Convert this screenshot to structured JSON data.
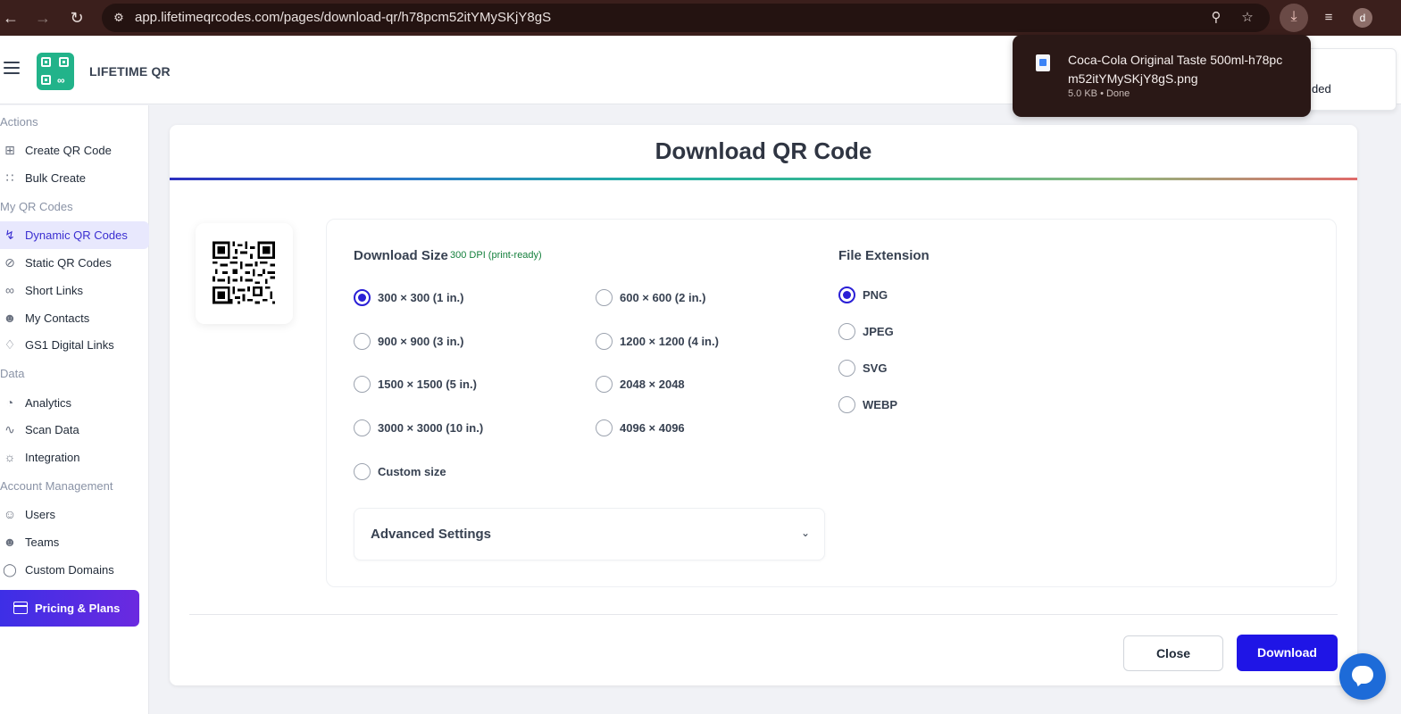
{
  "browser": {
    "url": "app.lifetimeqrcodes.com/pages/download-qr/h78pcm52itYMySKjY8gS",
    "profile_initial": "d",
    "download": {
      "filename": "Coca-Cola Original Taste 500ml-h78pcm52itYMySKjY8gS.png",
      "meta": "5.0 KB • Done"
    }
  },
  "header": {
    "brand": "LIFETIME QR",
    "notice_fragment": "ded"
  },
  "sidebar": {
    "sections": {
      "actions": "Actions",
      "my_qr_codes": "My QR Codes",
      "data": "Data",
      "account": "Account Management"
    },
    "items": [
      {
        "label": "Create QR Code",
        "icon": "plus-square-icon"
      },
      {
        "label": "Bulk Create",
        "icon": "grid-icon"
      },
      {
        "label": "Dynamic QR Codes",
        "icon": "lightning-icon"
      },
      {
        "label": "Static QR Codes",
        "icon": "lightning-off-icon"
      },
      {
        "label": "Short Links",
        "icon": "link-icon"
      },
      {
        "label": "My Contacts",
        "icon": "contacts-icon"
      },
      {
        "label": "GS1 Digital Links",
        "icon": "tag-icon"
      },
      {
        "label": "Analytics",
        "icon": "pie-chart-icon"
      },
      {
        "label": "Scan Data",
        "icon": "activity-icon"
      },
      {
        "label": "Integration",
        "icon": "plug-icon"
      },
      {
        "label": "Users",
        "icon": "user-plus-icon"
      },
      {
        "label": "Teams",
        "icon": "team-icon"
      },
      {
        "label": "Custom Domains",
        "icon": "shield-icon"
      }
    ],
    "pricing_label": "Pricing & Plans"
  },
  "modal": {
    "title": "Download QR Code",
    "download_size_label": "Download Size",
    "dpi_note": "300 DPI (print-ready)",
    "file_extension_label": "File Extension",
    "sizes": [
      "300 × 300 (1 in.)",
      "600 × 600 (2 in.)",
      "900 × 900 (3 in.)",
      "1200 × 1200 (4 in.)",
      "1500 × 1500 (5 in.)",
      "2048 × 2048",
      "3000 × 3000 (10 in.)",
      "4096 × 4096",
      "Custom size"
    ],
    "selected_size": "300 × 300 (1 in.)",
    "extensions": [
      "PNG",
      "JPEG",
      "SVG",
      "WEBP"
    ],
    "selected_extension": "PNG",
    "advanced_settings_label": "Advanced Settings",
    "close_label": "Close",
    "download_label": "Download"
  },
  "colors": {
    "accent": "#1f15e6",
    "active_nav_bg": "#e8e8fd",
    "logo_green": "#22b38a",
    "browser_chrome": "#3b1f1c"
  }
}
